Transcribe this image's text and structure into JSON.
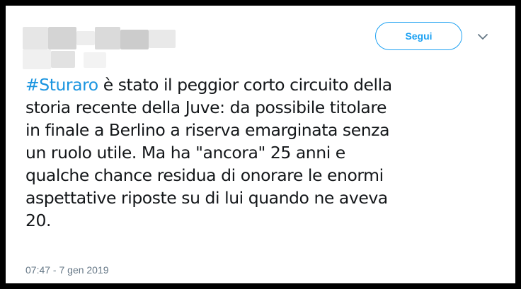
{
  "header": {
    "follow_label": "Segui",
    "chevron_icon": "chevron-down-icon"
  },
  "tweet": {
    "hashtag": "#Sturaro",
    "lines": [
      " è stato il peggior corto circuito della",
      "storia recente della Juve: da possibile titolare",
      "in finale a Berlino a riserva emarginata senza",
      "un ruolo utile. Ma ha \"ancora\" 25 anni e",
      "qualche chance residua di onorare le enormi",
      "aspettative riposte su di lui quando ne aveva",
      "20."
    ],
    "timestamp": "07:47 - 7 gen 2019"
  },
  "colors": {
    "accent": "#1da1f2",
    "hashtag": "#1b95e0",
    "text": "#14171a",
    "muted": "#657786",
    "frame": "#000000"
  }
}
